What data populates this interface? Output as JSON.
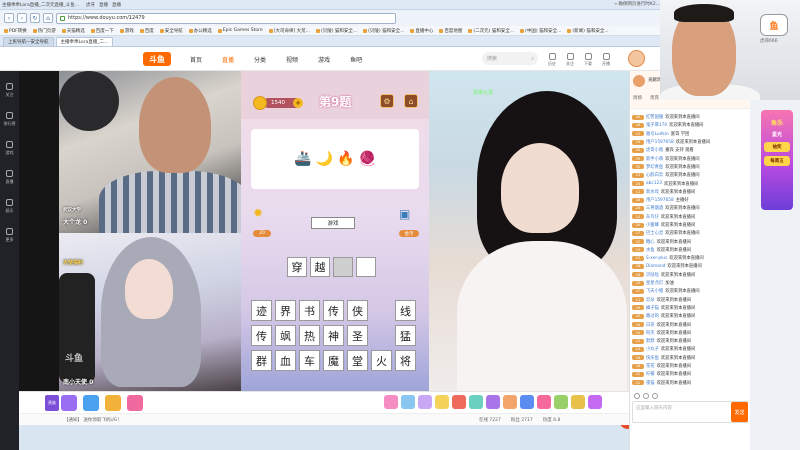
{
  "browser": {
    "tabs": [
      "主播乖乖Lora直播_二次元直播_斗鱼直播 -猫和安全浏览器",
      "虎牙",
      "直播",
      "直播"
    ],
    "title_right": "« 确保网页进行时K2...",
    "url": "https://www.douyu.com/12479",
    "bookmarks": [
      "PDF转换",
      "热门页游",
      "天猫精选",
      "百度一下",
      "游戏",
      "百度",
      "安全导航",
      "办公精选",
      "Epic Games Store",
      "[大司命律] 大荒...",
      "(贝陵) 猫和安全...",
      "(贝陵) 猫和安全...",
      "直播中心",
      "百度地图",
      "(二次元) 猫和安全...",
      "(中国) 猫和安全...",
      "(新闻) 猫和安全..."
    ],
    "page_tabs": [
      "上民导航—安全导航",
      "主播乖乖Lora直播_二..."
    ]
  },
  "header": {
    "logo": "斗鱼",
    "nav": [
      "首页",
      "直播",
      "分类",
      "视频",
      "游戏",
      "鱼吧"
    ],
    "search_placeholder": "搜索",
    "icons": [
      "历史",
      "关注",
      "下载",
      "开播"
    ]
  },
  "sidebar": [
    "关注",
    "排行榜",
    "游戏",
    "直播",
    "娱乐",
    "更多"
  ],
  "cams": {
    "top_left_label": "大个龙 0",
    "top_left_sub": "武汉大学",
    "bottom_left_label": "南小天使 0",
    "bottom_left_sub": "天使福利",
    "right_badge": "异世火龙",
    "watermark": "斗鱼"
  },
  "game": {
    "coins": "1540",
    "level": "第9题",
    "puzzle_emojis": [
      "🚢",
      "🌙",
      "🔥",
      "🧶"
    ],
    "hint_count": "20",
    "scene_label": "游戏",
    "scene_count": "金币",
    "answer": [
      "穿",
      "越",
      "",
      ""
    ],
    "tiles": [
      [
        "迹",
        "界",
        "书",
        "传",
        "侠",
        "",
        "线"
      ],
      [
        "传",
        "飒",
        "热",
        "神",
        "圣",
        "",
        "猛"
      ],
      [
        "群",
        "血",
        "车",
        "魔",
        "堂",
        "火",
        "将"
      ]
    ]
  },
  "giftbar": {
    "tag": "贵族",
    "notice": "【通知】 送你领取飞机UG！",
    "counts": [
      "在线 7227",
      "粉丝 2717",
      "热度 6.8"
    ]
  },
  "rpanel": {
    "rank_text": "贡献周榜 · 贵宾 1",
    "tabs": [
      "周榜",
      "贵宾",
      "粉丝团"
    ],
    "messages": [
      {
        "lv": "30",
        "name": "红警国服",
        "text": "欢迎来到本直播间"
      },
      {
        "lv": "16",
        "name": "鬼子厚170",
        "text": "欢迎来到本直播间"
      },
      {
        "lv": "12",
        "name": "雅号Ludkin",
        "text": "富哥 学团"
      },
      {
        "lv": "23",
        "name": "用户1597658",
        "text": "欢迎来到本直播间"
      },
      {
        "lv": "10",
        "name": "虎哥小观",
        "text": "嘉宾 支持 观看"
      },
      {
        "lv": "19",
        "name": "新手小萌",
        "text": "欢迎来到本直播间"
      },
      {
        "lv": "30",
        "name": "梦幻青鱼",
        "text": "欢迎来到本直播间"
      },
      {
        "lv": "13",
        "name": "心醉白云",
        "text": "欢迎来到本直播间"
      },
      {
        "lv": "24",
        "name": "abc123",
        "text": "欢迎来到本直播间"
      },
      {
        "lv": "11",
        "name": "新水母",
        "text": "欢迎来到本直播间"
      },
      {
        "lv": "18",
        "name": "用户1597658",
        "text": "主播好"
      },
      {
        "lv": "25",
        "name": "三男烟酒",
        "text": "欢迎来到本直播间"
      },
      {
        "lv": "14",
        "name": "灰鸟仔",
        "text": "欢迎来到本直播间"
      },
      {
        "lv": "20",
        "name": "小蜜蜂",
        "text": "欢迎来到本直播间"
      },
      {
        "lv": "17",
        "name": "巴士心灵",
        "text": "欢迎来到本直播间"
      },
      {
        "lv": "22",
        "name": "糖心",
        "text": "欢迎来到本直播间"
      },
      {
        "lv": "12",
        "name": "水鱼",
        "text": "欢迎来到本直播间"
      },
      {
        "lv": "13",
        "name": "S-xer-plus",
        "text": "欢迎来到本直播间"
      },
      {
        "lv": "28",
        "name": "Diamond",
        "text": "欢迎来到本直播间"
      },
      {
        "lv": "16",
        "name": "贝哒哒",
        "text": "欢迎来到本直播间"
      },
      {
        "lv": "15",
        "name": "星星点灯",
        "text": "加油"
      },
      {
        "lv": "27",
        "name": "飞天小猪",
        "text": "欢迎来到本直播间"
      },
      {
        "lv": "11",
        "name": "云朵",
        "text": "欢迎来到本直播间"
      },
      {
        "lv": "19",
        "name": "橘子猫",
        "text": "欢迎来到本直播间"
      },
      {
        "lv": "20",
        "name": "路过的",
        "text": "欢迎来到本直播间"
      },
      {
        "lv": "24",
        "name": "白茶",
        "text": "欢迎来到本直播间"
      },
      {
        "lv": "10",
        "name": "阿杰",
        "text": "欢迎来到本直播间"
      },
      {
        "lv": "21",
        "name": "默默",
        "text": "欢迎来到本直播间"
      },
      {
        "lv": "14",
        "name": "小丸子",
        "text": "欢迎来到本直播间"
      },
      {
        "lv": "16",
        "name": "快乐鱼",
        "text": "欢迎来到本直播间"
      },
      {
        "lv": "18",
        "name": "花花",
        "text": "欢迎来到本直播间"
      },
      {
        "lv": "22",
        "name": "柠檬",
        "text": "欢迎来到本直播间"
      },
      {
        "lv": "12",
        "name": "夜猫",
        "text": "欢迎来到本直播间"
      }
    ],
    "input_placeholder": "这里输入聊天内容",
    "send": "发送"
  },
  "promo": {
    "title": "鱼乐",
    "subtitle": "星光",
    "badge": "抽奖",
    "badge2": "每周五"
  },
  "streamer": {
    "logo": "鱼",
    "sub": "虎哥666"
  }
}
